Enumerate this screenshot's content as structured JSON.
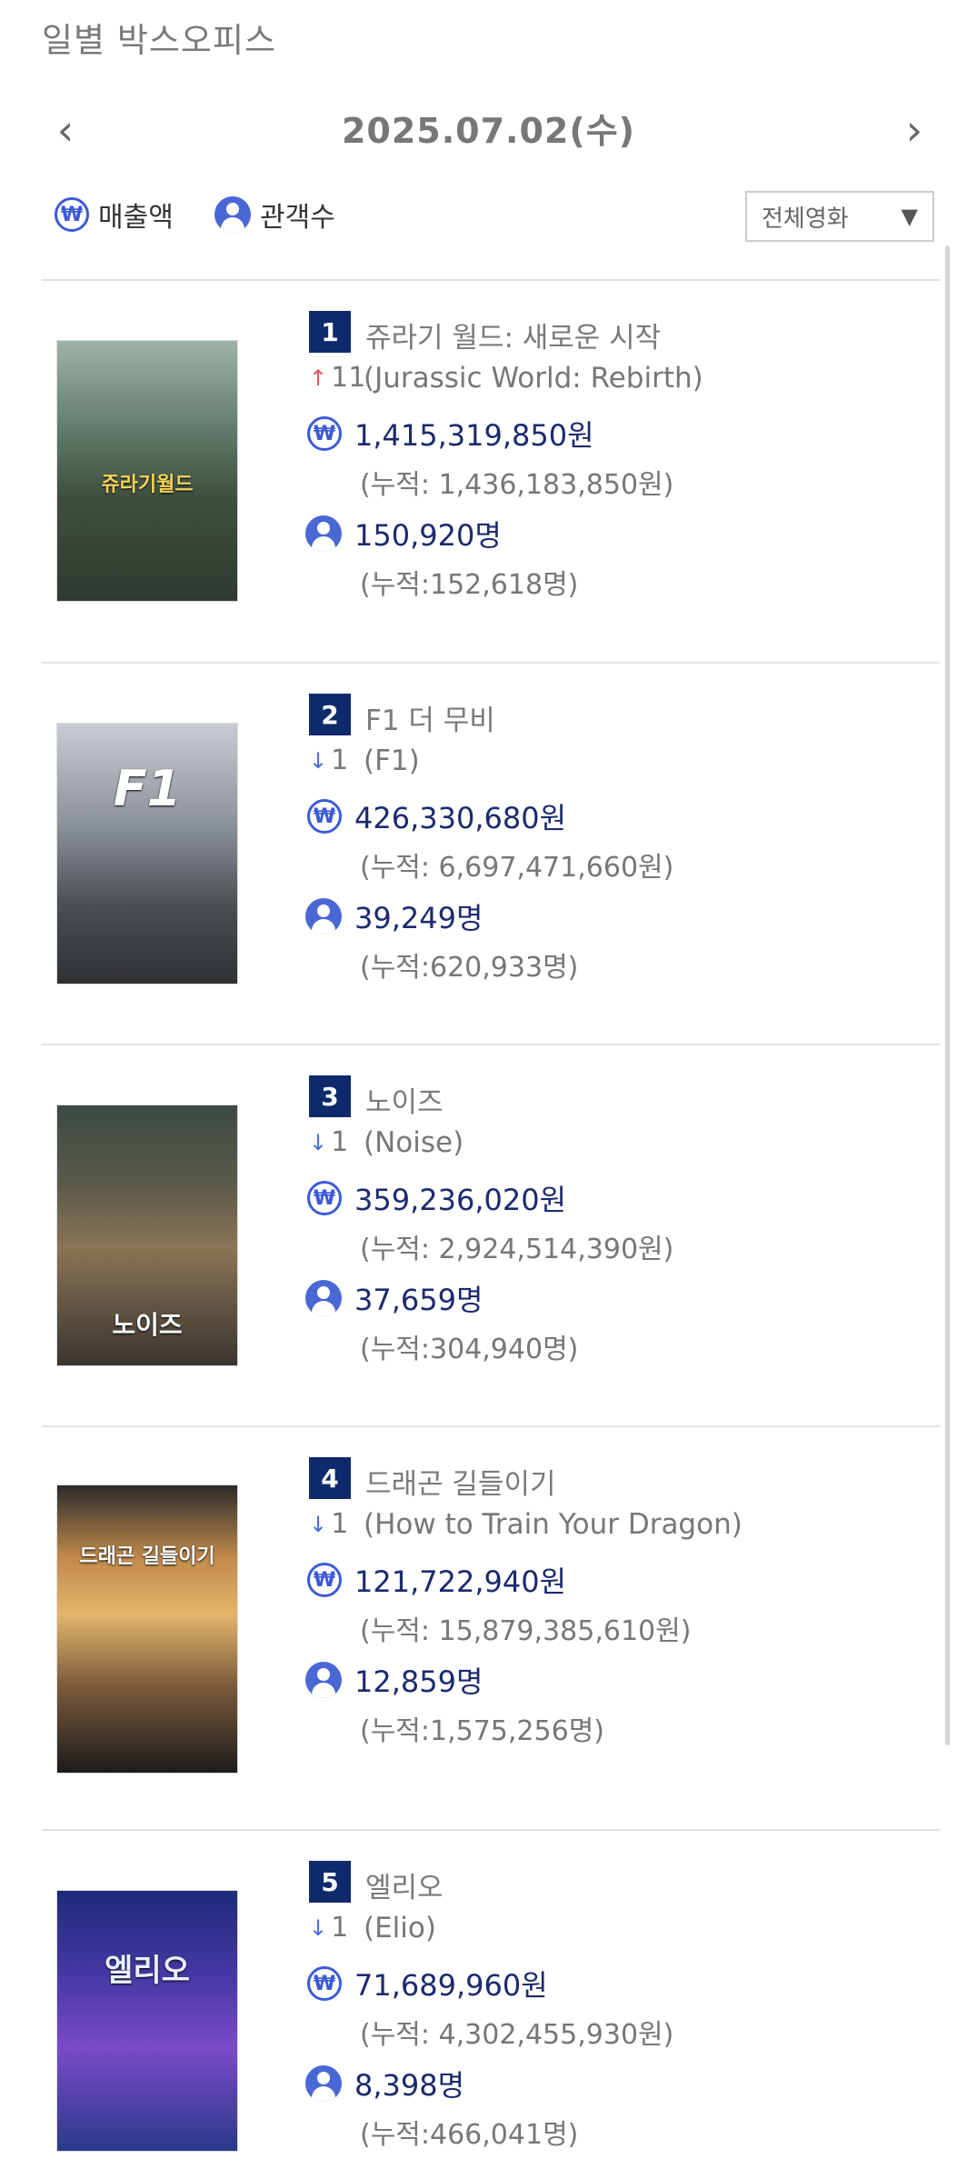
{
  "header": {
    "title": "일별 박스오피스",
    "date": "2025.07.02(수)",
    "prev_icon": "‹",
    "next_icon": "›"
  },
  "legend": {
    "sales_label": "매출액",
    "audience_label": "관객수",
    "sales_icon": "won-coin-icon",
    "audience_icon": "person-icon"
  },
  "filter": {
    "selected": "전체영화",
    "arrow": "▼"
  },
  "colors": {
    "accent": "#0f2a6b",
    "icon_blue": "#3b5ad8",
    "rank_up": "#e05555",
    "rank_down": "#4a6fd8"
  },
  "movies": [
    {
      "rank": "1",
      "title": "쥬라기 월드: 새로운 시작",
      "change_dir": "up",
      "change_arrow": "↑",
      "change": "11",
      "original_title": "(Jurassic World: Rebirth)",
      "sales": "1,415,319,850원",
      "sales_cumulative": "(누적: 1,436,183,850원)",
      "audience": "150,920명",
      "audience_cumulative": "(누적:152,618명)",
      "poster_text": "쥬라기월드"
    },
    {
      "rank": "2",
      "title": "F1 더 무비",
      "change_dir": "down",
      "change_arrow": "↓",
      "change": "1",
      "original_title": "(F1)",
      "sales": "426,330,680원",
      "sales_cumulative": "(누적: 6,697,471,660원)",
      "audience": "39,249명",
      "audience_cumulative": "(누적:620,933명)",
      "poster_text": "F1"
    },
    {
      "rank": "3",
      "title": "노이즈",
      "change_dir": "down",
      "change_arrow": "↓",
      "change": "1",
      "original_title": "(Noise)",
      "sales": "359,236,020원",
      "sales_cumulative": "(누적: 2,924,514,390원)",
      "audience": "37,659명",
      "audience_cumulative": "(누적:304,940명)",
      "poster_text": "노이즈"
    },
    {
      "rank": "4",
      "title": "드래곤 길들이기",
      "change_dir": "down",
      "change_arrow": "↓",
      "change": "1",
      "original_title": "(How to Train Your Dragon)",
      "sales": "121,722,940원",
      "sales_cumulative": "(누적: 15,879,385,610원)",
      "audience": "12,859명",
      "audience_cumulative": "(누적:1,575,256명)",
      "poster_text": "드래곤 길들이기"
    },
    {
      "rank": "5",
      "title": "엘리오",
      "change_dir": "down",
      "change_arrow": "↓",
      "change": "1",
      "original_title": "(Elio)",
      "sales": "71,689,960원",
      "sales_cumulative": "(누적: 4,302,455,930원)",
      "audience": "8,398명",
      "audience_cumulative": "(누적:466,041명)",
      "poster_text": "엘리오"
    }
  ]
}
